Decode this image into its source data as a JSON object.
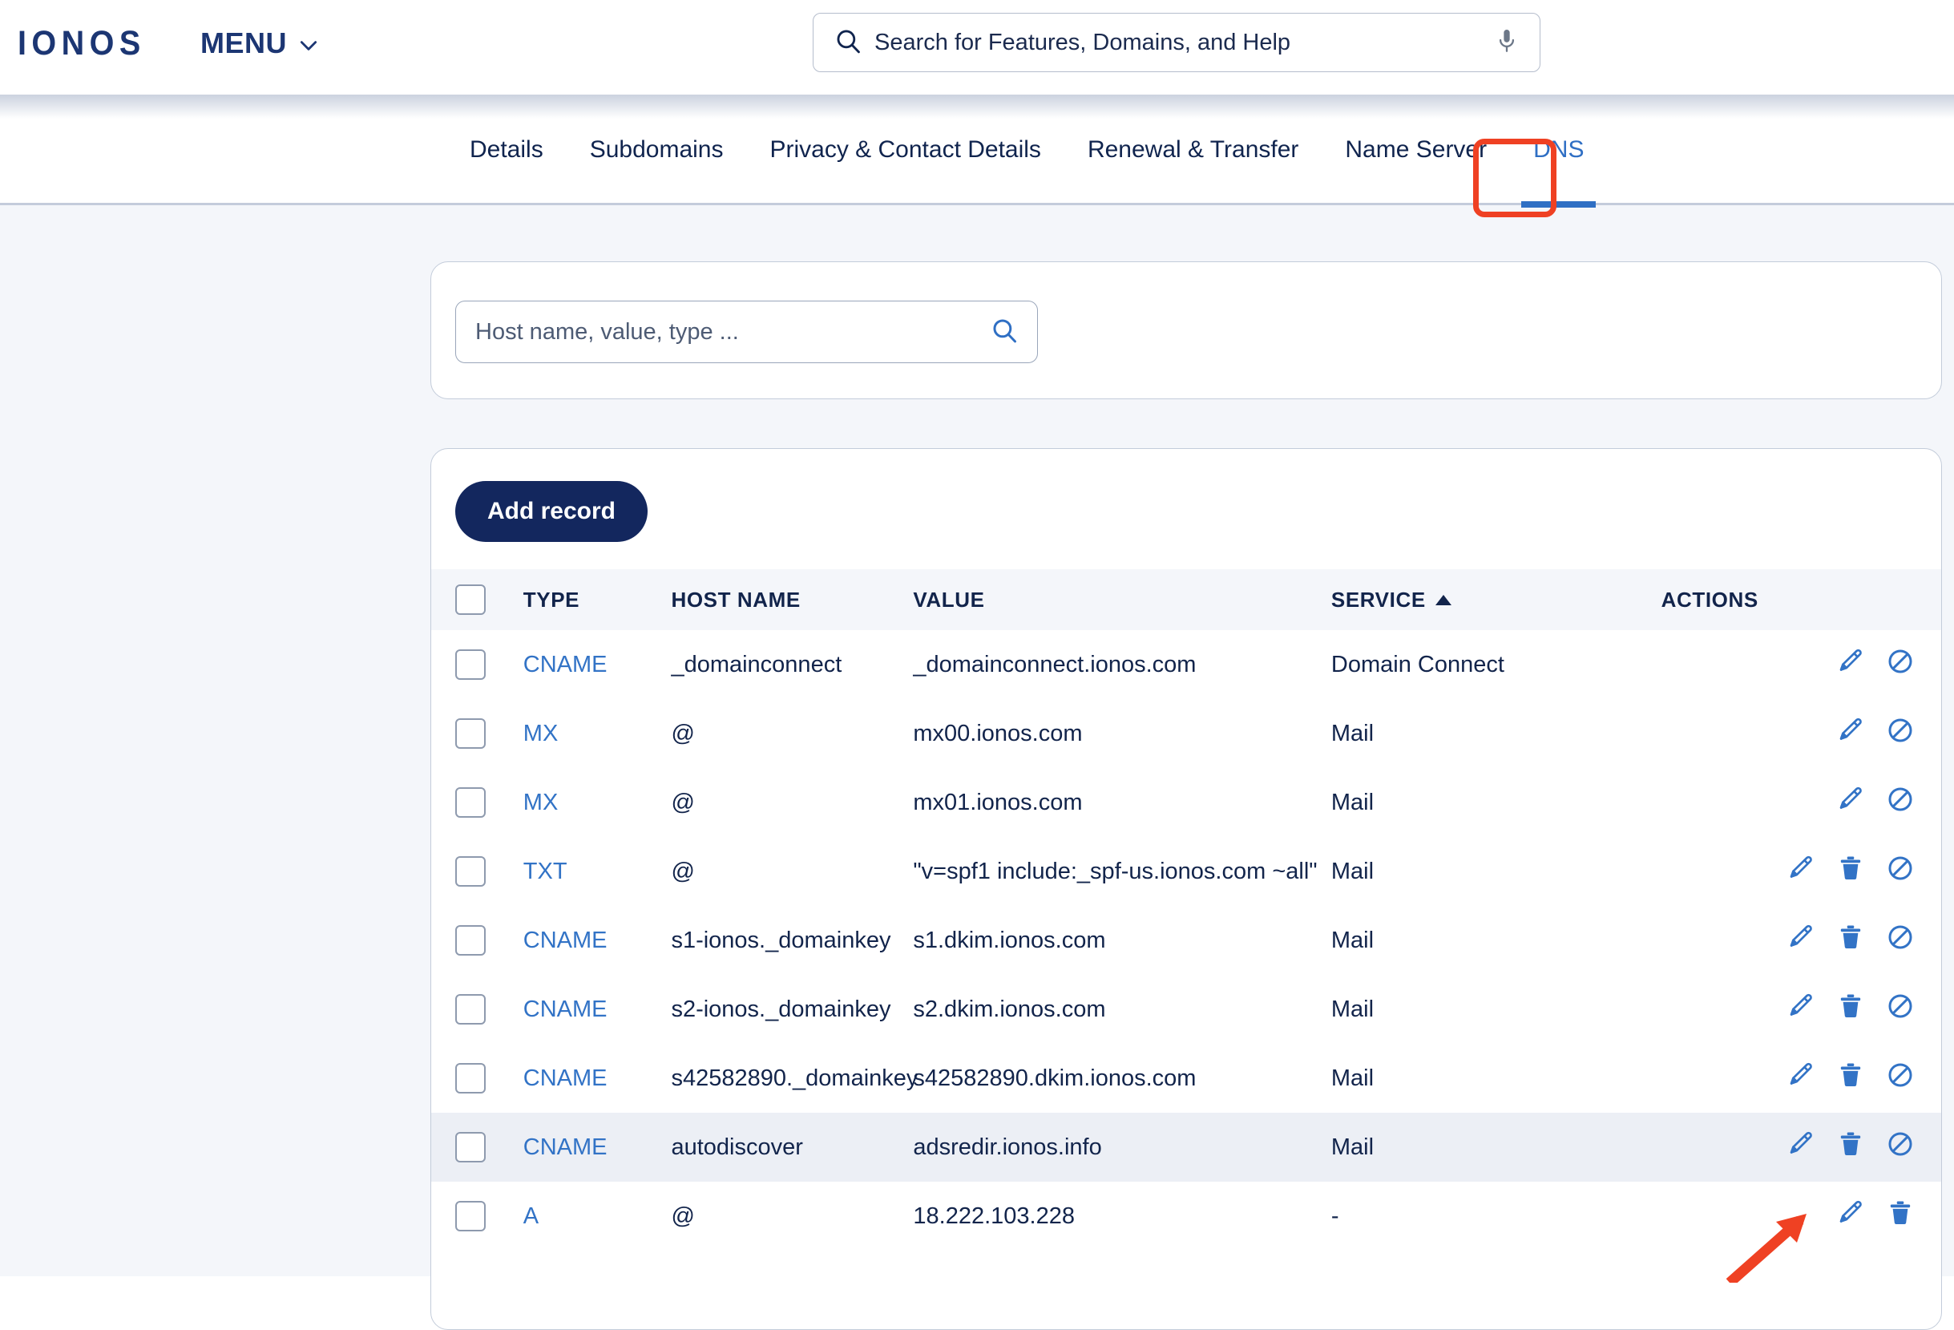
{
  "brand": {
    "logo_text": "IONOS",
    "menu_label": "MENU",
    "accent_blue": "#2f6fc4",
    "navy": "#13275e",
    "annotation_red": "#ef4123"
  },
  "global_search": {
    "placeholder": "Search for Features, Domains, and Help",
    "value": "",
    "search_icon": "search-icon",
    "mic_icon": "microphone-icon"
  },
  "tabs": [
    {
      "label": "Details",
      "active": false
    },
    {
      "label": "Subdomains",
      "active": false
    },
    {
      "label": "Privacy & Contact Details",
      "active": false
    },
    {
      "label": "Renewal & Transfer",
      "active": false
    },
    {
      "label": "Name Server",
      "active": false
    },
    {
      "label": "DNS",
      "active": true
    }
  ],
  "record_search": {
    "placeholder": "Host name, value, type ...",
    "value": "",
    "search_icon": "search-icon"
  },
  "toolbar": {
    "add_record_label": "Add record"
  },
  "table": {
    "headers": {
      "type": "TYPE",
      "host_name": "HOST NAME",
      "value": "VALUE",
      "service": "SERVICE",
      "actions": "ACTIONS"
    },
    "sort": {
      "column": "SERVICE",
      "direction": "asc",
      "caret": "caret-up-icon"
    },
    "rows": [
      {
        "type": "CNAME",
        "host": "_domainconnect",
        "value": "_domainconnect.ionos.com",
        "service": "Domain Connect",
        "actions": [
          "edit-icon",
          "disable-icon"
        ],
        "hovered": false
      },
      {
        "type": "MX",
        "host": "@",
        "value": "mx00.ionos.com",
        "service": "Mail",
        "actions": [
          "edit-icon",
          "disable-icon"
        ],
        "hovered": false
      },
      {
        "type": "MX",
        "host": "@",
        "value": "mx01.ionos.com",
        "service": "Mail",
        "actions": [
          "edit-icon",
          "disable-icon"
        ],
        "hovered": false
      },
      {
        "type": "TXT",
        "host": "@",
        "value": "\"v=spf1 include:_spf-us.ionos.com ~all\"",
        "service": "Mail",
        "actions": [
          "edit-icon",
          "delete-icon",
          "disable-icon"
        ],
        "hovered": false
      },
      {
        "type": "CNAME",
        "host": "s1-ionos._domainkey",
        "value": "s1.dkim.ionos.com",
        "service": "Mail",
        "actions": [
          "edit-icon",
          "delete-icon",
          "disable-icon"
        ],
        "hovered": false
      },
      {
        "type": "CNAME",
        "host": "s2-ionos._domainkey",
        "value": "s2.dkim.ionos.com",
        "service": "Mail",
        "actions": [
          "edit-icon",
          "delete-icon",
          "disable-icon"
        ],
        "hovered": false
      },
      {
        "type": "CNAME",
        "host": "s42582890._domainkey",
        "value": "s42582890.dkim.ionos.com",
        "service": "Mail",
        "actions": [
          "edit-icon",
          "delete-icon",
          "disable-icon"
        ],
        "hovered": false
      },
      {
        "type": "CNAME",
        "host": "autodiscover",
        "value": "adsredir.ionos.info",
        "service": "Mail",
        "actions": [
          "edit-icon",
          "delete-icon",
          "disable-icon"
        ],
        "hovered": true
      },
      {
        "type": "A",
        "host": "@",
        "value": "18.222.103.228",
        "service": "-",
        "actions": [
          "edit-icon",
          "delete-icon"
        ],
        "hovered": false
      }
    ]
  },
  "annotations": {
    "tab_highlight": "DNS",
    "arrow_target": "edit-icon-row-9"
  }
}
